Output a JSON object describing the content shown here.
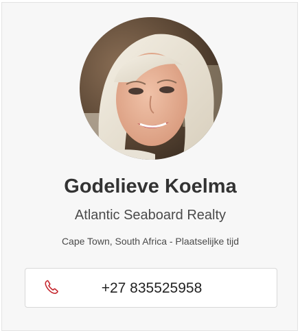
{
  "agent": {
    "name": "Godelieve Koelma",
    "company": "Atlantic Seaboard Realty",
    "location": "Cape Town, South Africa - Plaatselijke tijd",
    "phone": "+27 835525958",
    "phone_icon": "phone-icon"
  },
  "colors": {
    "accent": "#c4242b",
    "card_background": "#f7f7f7",
    "text": "#333333"
  }
}
